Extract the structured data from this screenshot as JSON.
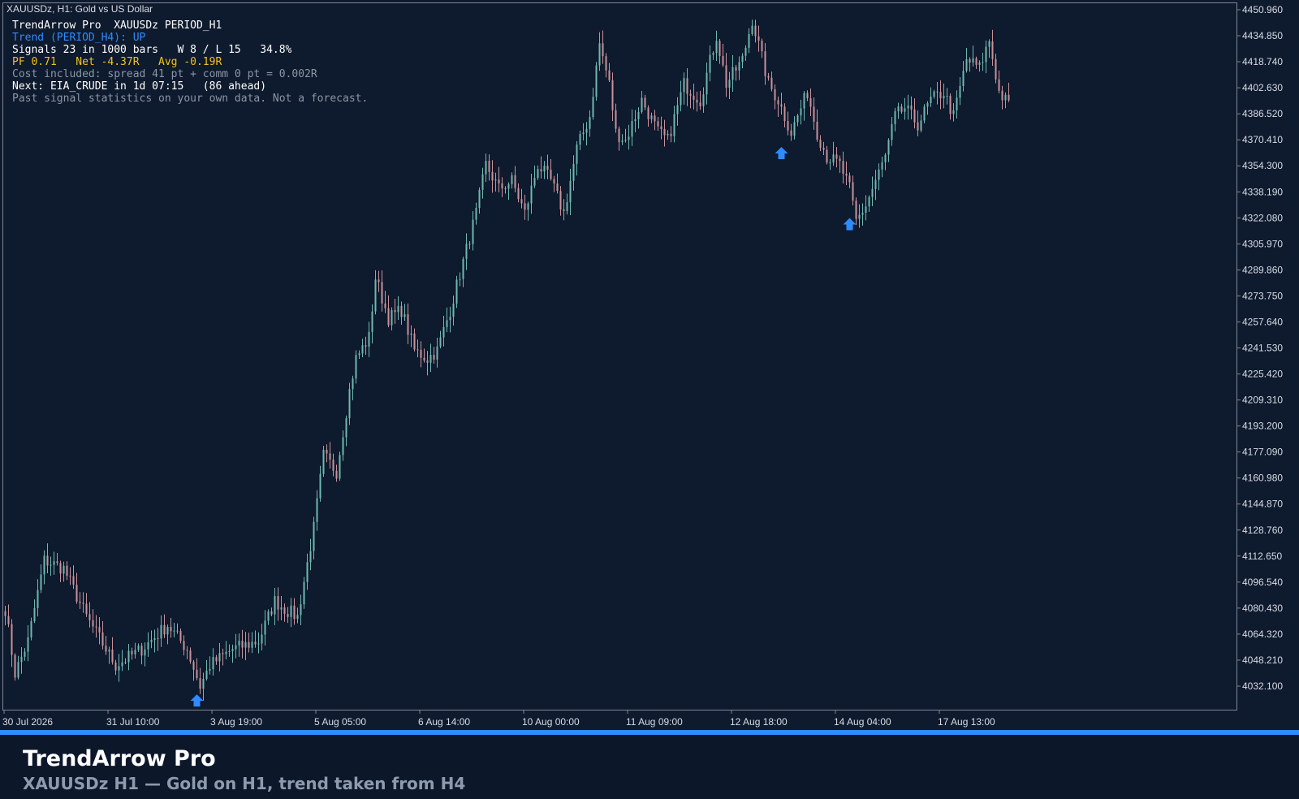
{
  "window": {
    "title": "XAUUSDz, H1:  Gold vs US Dollar"
  },
  "indicator": {
    "lines": [
      {
        "text": "TrendArrow Pro  XAUUSDz PERIOD_H1",
        "color": "#ffffff"
      },
      {
        "text": "Trend (PERIOD_H4): UP",
        "color": "#2f8cff"
      },
      {
        "text": "Signals 23 in 1000 bars   W 8 / L 15   34.8%",
        "color": "#ffffff"
      },
      {
        "text": "PF 0.71   Net -4.37R   Avg -0.19R",
        "color": "#f2c21b"
      },
      {
        "text": "Cost included: spread 41 pt + comm 0 pt = 0.002R",
        "color": "#8c96a6"
      },
      {
        "text": "Next: EIA_CRUDE in 1d 07:15   (86 ahead)",
        "color": "#ffffff"
      },
      {
        "text": "Past signal statistics on your own data. Not a forecast.",
        "color": "#8c96a6"
      }
    ]
  },
  "colors": {
    "background": "#0e1a2d",
    "bull_candle": "#6fb8b0",
    "bear_candle": "#c9929a",
    "signal_arrow": "#2f8cff",
    "accent_bar": "#2f8cff",
    "axis_text": "#d8dde6"
  },
  "chart_data": {
    "type": "candlestick",
    "symbol": "XAUUSDz",
    "timeframe": "H1",
    "ylim": [
      4020.0,
      4455.0
    ],
    "price_ticks": [
      4450.96,
      4434.85,
      4418.74,
      4402.63,
      4386.52,
      4370.41,
      4354.3,
      4338.19,
      4322.08,
      4305.97,
      4289.86,
      4273.75,
      4257.64,
      4241.53,
      4225.42,
      4209.31,
      4193.2,
      4177.09,
      4160.98,
      4144.87,
      4128.76,
      4112.65,
      4096.54,
      4080.43,
      4064.32,
      4048.21,
      4032.1
    ],
    "time_labels": [
      "30 Jul 2026",
      "31 Jul 10:00",
      "3 Aug 19:00",
      "5 Aug 05:00",
      "6 Aug 14:00",
      "10 Aug 00:00",
      "11 Aug 09:00",
      "12 Aug 18:00",
      "14 Aug 04:00",
      "17 Aug 13:00"
    ],
    "bars_per_label": 32,
    "path_anchors": [
      [
        0,
        4080
      ],
      [
        3,
        4040
      ],
      [
        7,
        4060
      ],
      [
        12,
        4110
      ],
      [
        18,
        4105
      ],
      [
        25,
        4075
      ],
      [
        34,
        4045
      ],
      [
        42,
        4055
      ],
      [
        50,
        4070
      ],
      [
        56,
        4055
      ],
      [
        60,
        4032
      ],
      [
        63,
        4045
      ],
      [
        70,
        4055
      ],
      [
        78,
        4060
      ],
      [
        83,
        4085
      ],
      [
        86,
        4080
      ],
      [
        90,
        4075
      ],
      [
        95,
        4130
      ],
      [
        98,
        4175
      ],
      [
        102,
        4165
      ],
      [
        106,
        4215
      ],
      [
        108,
        4235
      ],
      [
        112,
        4248
      ],
      [
        114,
        4285
      ],
      [
        118,
        4260
      ],
      [
        122,
        4265
      ],
      [
        126,
        4240
      ],
      [
        130,
        4235
      ],
      [
        133,
        4240
      ],
      [
        137,
        4265
      ],
      [
        141,
        4295
      ],
      [
        145,
        4325
      ],
      [
        148,
        4355
      ],
      [
        152,
        4340
      ],
      [
        156,
        4345
      ],
      [
        160,
        4325
      ],
      [
        164,
        4355
      ],
      [
        168,
        4345
      ],
      [
        172,
        4325
      ],
      [
        176,
        4365
      ],
      [
        180,
        4385
      ],
      [
        183,
        4430
      ],
      [
        186,
        4405
      ],
      [
        188,
        4375
      ],
      [
        191,
        4370
      ],
      [
        196,
        4395
      ],
      [
        201,
        4375
      ],
      [
        204,
        4370
      ],
      [
        209,
        4405
      ],
      [
        214,
        4395
      ],
      [
        219,
        4435
      ],
      [
        222,
        4405
      ],
      [
        227,
        4420
      ],
      [
        230,
        4445
      ],
      [
        235,
        4405
      ],
      [
        238,
        4395
      ],
      [
        242,
        4375
      ],
      [
        245,
        4390
      ],
      [
        247,
        4400
      ],
      [
        250,
        4375
      ],
      [
        253,
        4360
      ],
      [
        257,
        4355
      ],
      [
        260,
        4340
      ],
      [
        262,
        4320
      ],
      [
        265,
        4330
      ],
      [
        268,
        4345
      ],
      [
        271,
        4360
      ],
      [
        274,
        4385
      ],
      [
        277,
        4390
      ],
      [
        281,
        4380
      ],
      [
        285,
        4395
      ],
      [
        289,
        4400
      ],
      [
        292,
        4385
      ],
      [
        296,
        4420
      ],
      [
        300,
        4415
      ],
      [
        303,
        4432
      ],
      [
        306,
        4400
      ],
      [
        309,
        4392
      ]
    ],
    "signals": [
      {
        "direction": "up",
        "bar": 59,
        "price": 4027.0
      },
      {
        "direction": "up",
        "bar": 239,
        "price": 4366.0
      },
      {
        "direction": "up",
        "bar": 260,
        "price": 4322.0
      }
    ]
  },
  "footer": {
    "title": "TrendArrow Pro",
    "subtitle": "XAUUSDz  H1  —  Gold on H1, trend taken from H4"
  }
}
